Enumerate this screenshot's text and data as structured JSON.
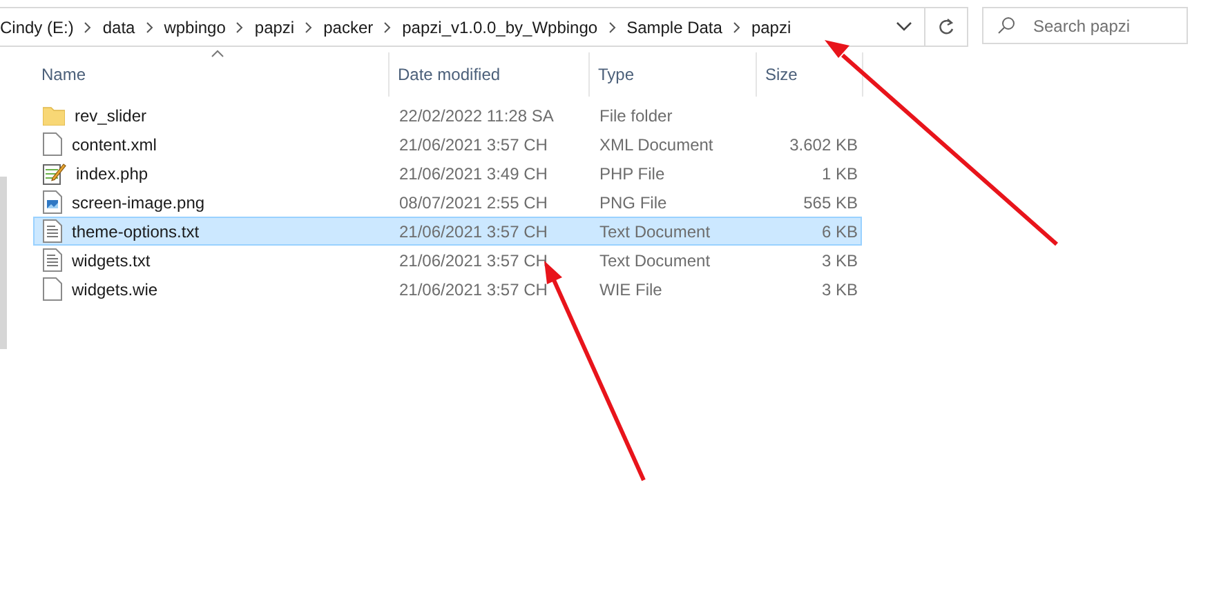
{
  "breadcrumb": [
    "Cindy (E:)",
    "data",
    "wpbingo",
    "papzi",
    "packer",
    "papzi_v1.0.0_by_Wpbingo",
    "Sample Data",
    "papzi"
  ],
  "search": {
    "placeholder": "Search papzi"
  },
  "columns": [
    {
      "label": "Name",
      "sorted": true
    },
    {
      "label": "Date modified",
      "sorted": false
    },
    {
      "label": "Type",
      "sorted": false
    },
    {
      "label": "Size",
      "sorted": false
    }
  ],
  "files": [
    {
      "kind": "folder",
      "name": "rev_slider",
      "date": "22/02/2022 11:28 SA",
      "type": "File folder",
      "selected": false
    },
    {
      "kind": "file",
      "name": "content.xml",
      "date": "21/06/2021 3:57 CH",
      "type": "XML Document",
      "size": "3.602 KB",
      "selected": false
    },
    {
      "kind": "php",
      "name": "index.php",
      "date": "21/06/2021 3:49 CH",
      "type": "PHP File",
      "size": "1 KB",
      "selected": false
    },
    {
      "kind": "image",
      "name": "screen-image.png",
      "date": "08/07/2021 2:55 CH",
      "type": "PNG File",
      "size": "565 KB",
      "selected": false
    },
    {
      "kind": "text",
      "name": "theme-options.txt",
      "date": "21/06/2021 3:57 CH",
      "type": "Text Document",
      "size": "6 KB",
      "selected": true
    },
    {
      "kind": "text",
      "name": "widgets.txt",
      "date": "21/06/2021 3:57 CH",
      "type": "Text Document",
      "size": "3 KB",
      "selected": false
    },
    {
      "kind": "file",
      "name": "widgets.wie",
      "date": "21/06/2021 3:57 CH",
      "type": "WIE File",
      "size": "3 KB",
      "selected": false
    }
  ]
}
